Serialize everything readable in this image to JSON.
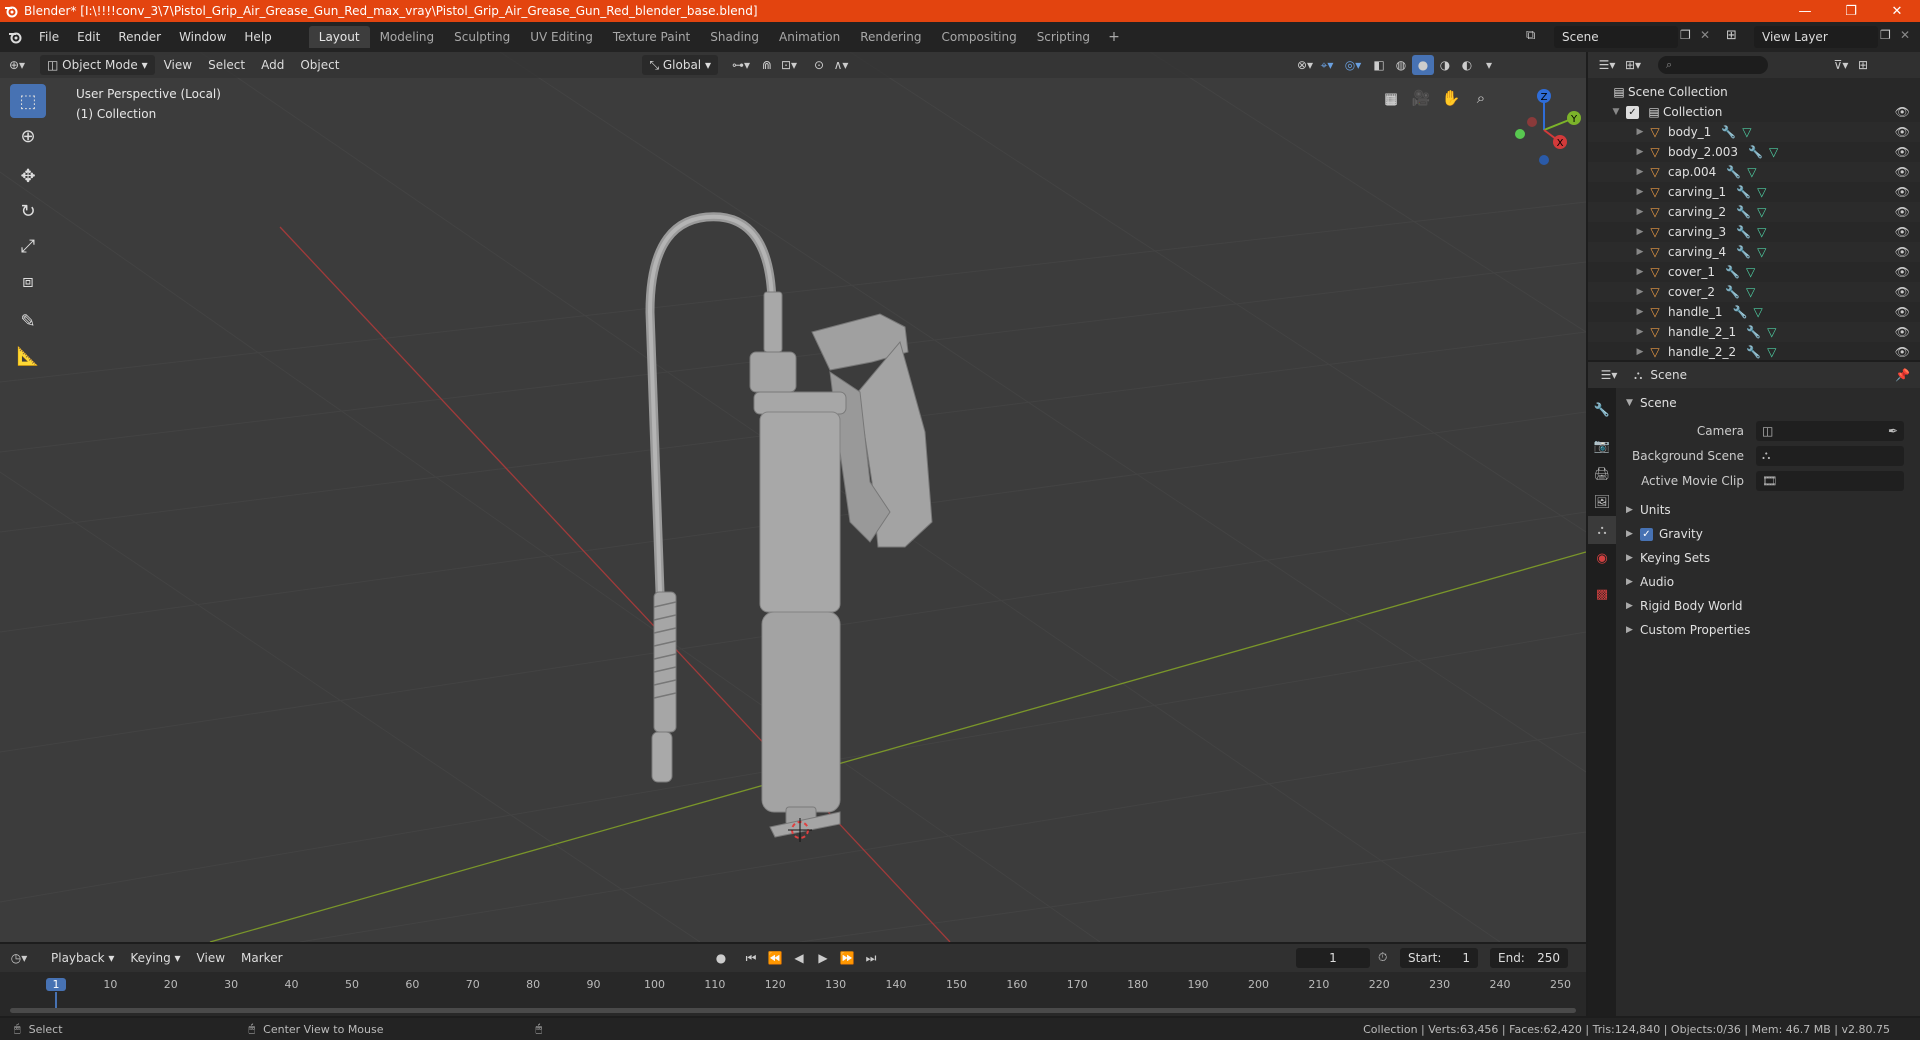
{
  "window": {
    "title": "Blender* [I:\\!!!!conv_3\\7\\Pistol_Grip_Air_Grease_Gun_Red_max_vray\\Pistol_Grip_Air_Grease_Gun_Red_blender_base.blend]",
    "minimize": "—",
    "maximize": "❐",
    "close": "✕"
  },
  "menu": [
    "File",
    "Edit",
    "Render",
    "Window",
    "Help"
  ],
  "workspaces": [
    "Layout",
    "Modeling",
    "Sculpting",
    "UV Editing",
    "Texture Paint",
    "Shading",
    "Animation",
    "Rendering",
    "Compositing",
    "Scripting"
  ],
  "active_workspace": "Layout",
  "scene_name": "Scene",
  "view_layer": "View Layer",
  "viewport": {
    "mode": "Object Mode",
    "menus": [
      "View",
      "Select",
      "Add",
      "Object"
    ],
    "transform_orientation": "Global",
    "info_line1": "User Perspective (Local)",
    "info_line2": "(1) Collection",
    "gizmo_labels": {
      "z": "Z",
      "y": "Y",
      "x": "X"
    }
  },
  "outliner": {
    "search_placeholder": "",
    "scene_collection": "Scene Collection",
    "collection": "Collection",
    "objects": [
      "body_1",
      "body_2.003",
      "cap.004",
      "carving_1",
      "carving_2",
      "carving_3",
      "carving_4",
      "cover_1",
      "cover_2",
      "handle_1",
      "handle_2_1",
      "handle_2_2"
    ]
  },
  "properties": {
    "header_title": "Scene",
    "panel_scene": "Scene",
    "camera_label": "Camera",
    "background_scene_label": "Background Scene",
    "active_movie_clip_label": "Active Movie Clip",
    "panels": [
      "Units",
      "Gravity",
      "Keying Sets",
      "Audio",
      "Rigid Body World",
      "Custom Properties"
    ]
  },
  "timeline": {
    "menus": [
      "Playback",
      "Keying",
      "View",
      "Marker"
    ],
    "current_frame": "1",
    "start_label": "Start:",
    "start_value": "1",
    "end_label": "End:",
    "end_value": "250",
    "ticks": [
      "1",
      "10",
      "20",
      "30",
      "40",
      "50",
      "60",
      "70",
      "80",
      "90",
      "100",
      "110",
      "120",
      "130",
      "140",
      "150",
      "160",
      "170",
      "180",
      "190",
      "200",
      "210",
      "220",
      "230",
      "240",
      "250"
    ]
  },
  "statusbar": {
    "left_action": "Select",
    "middle_action": "Center View to Mouse",
    "stats": "Collection | Verts:63,456 | Faces:62,420 | Tris:124,840 | Objects:0/36 | Mem: 46.7 MB | v2.80.75"
  }
}
